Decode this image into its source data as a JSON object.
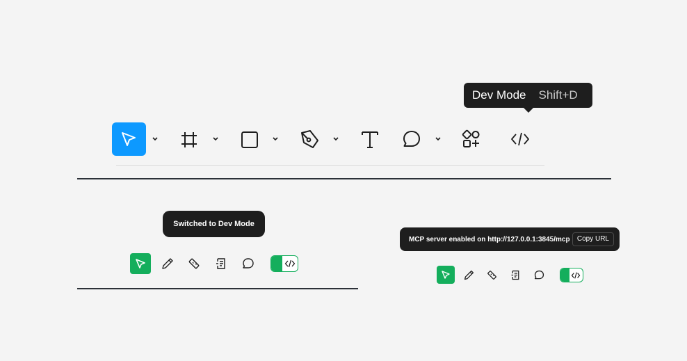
{
  "dev_mode_tooltip": {
    "label": "Dev Mode",
    "shortcut": "Shift+D"
  },
  "main_toolbar": {
    "tools": [
      {
        "name": "move-tool",
        "icon": "cursor-arrow-icon",
        "selected": true,
        "has_menu": true
      },
      {
        "name": "frame-tool",
        "icon": "frame-hash-icon",
        "has_menu": true
      },
      {
        "name": "shape-tool",
        "icon": "square-icon",
        "has_menu": true
      },
      {
        "name": "pen-tool",
        "icon": "pen-nib-icon",
        "has_menu": true
      },
      {
        "name": "text-tool",
        "icon": "text-t-icon",
        "has_menu": false
      },
      {
        "name": "comment-tool",
        "icon": "speech-bubble-icon",
        "has_menu": true
      },
      {
        "name": "resources-tool",
        "icon": "shapes-plus-icon",
        "has_menu": false
      },
      {
        "name": "dev-mode-tool",
        "icon": "code-brackets-icon",
        "has_menu": false
      }
    ],
    "accent_color": "#0d99ff"
  },
  "left_panel": {
    "toast": "Switched to Dev Mode",
    "accent_color": "#14ae5c"
  },
  "right_panel": {
    "toast": "MCP server enabled on http://127.0.0.1:3845/mcp",
    "copy_button": "Copy URL",
    "accent_color": "#14ae5c"
  }
}
